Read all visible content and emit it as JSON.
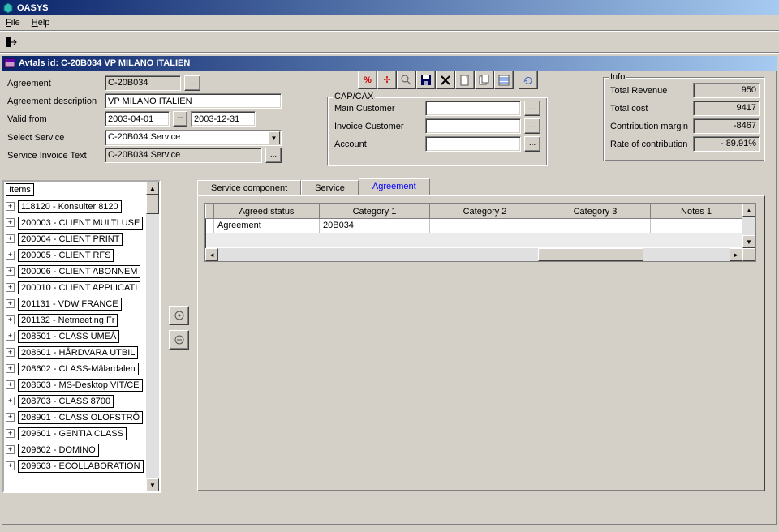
{
  "app_title": "OASYS",
  "menus": {
    "file": "File",
    "help": "Help"
  },
  "child_title": "Avtals id: C-20B034   VP MILANO ITALIEN",
  "form": {
    "agreement_label": "Agreement",
    "agreement_value": "C-20B034",
    "desc_label": "Agreement description",
    "desc_value": "VP MILANO ITALIEN",
    "valid_label": "Valid from",
    "valid_from": "2003-04-01",
    "valid_sep": "--",
    "valid_to": "2003-12-31",
    "select_service_label": "Select Service",
    "select_service_value": "C-20B034   Service",
    "service_invoice_label": "Service Invoice Text",
    "service_invoice_value": "C-20B034   Service"
  },
  "capcax": {
    "title": "CAP/CAX",
    "main_customer": "Main Customer",
    "invoice_customer": "Invoice Customer",
    "account": "Account"
  },
  "info": {
    "title": "Info",
    "total_revenue_label": "Total Revenue",
    "total_revenue": "950",
    "total_cost_label": "Total cost",
    "total_cost": "9417",
    "contrib_margin_label": "Contribution margin",
    "contrib_margin": "-8467",
    "rate_label": "Rate of contribution",
    "rate": "-   89.91%"
  },
  "tree": {
    "heading": "Items",
    "items": [
      "118120 - Konsulter 8120",
      "200003 - CLIENT MULTI USE",
      "200004 - CLIENT PRINT",
      "200005 - CLIENT RFS",
      "200006 - CLIENT ABONNEM",
      "200010 - CLIENT APPLICATI",
      "201131 - VDW FRANCE",
      "201132 - Netmeeting Fr",
      "208501 - CLASS UMEÅ",
      "208601 - HÅRDVARA UTBIL",
      "208602 - CLASS-Mälardalen",
      "208603 - MS-Desktop VIT/CE",
      "208703 - CLASS 8700",
      "208901 - CLASS OLOFSTRÖ",
      "209601 - GENTIA CLASS",
      "209602 - DOMINO",
      "209603 - ECOLLABORATION"
    ]
  },
  "tabs": {
    "service_component": "Service component",
    "service": "Service",
    "agreement": "Agreement"
  },
  "grid": {
    "headers": [
      "Agreed status",
      "Category 1",
      "Category 2",
      "Category 3",
      "Notes 1"
    ],
    "row": {
      "agreed_status": "Agreement",
      "cat1": "20B034",
      "cat2": "",
      "cat3": "",
      "notes1": ""
    }
  }
}
